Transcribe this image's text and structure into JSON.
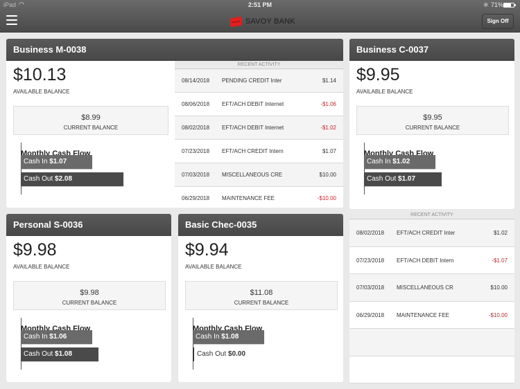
{
  "status_bar": {
    "carrier": "iPad",
    "time": "2:51 PM",
    "battery_pct": "71%",
    "battery_level": 0.71
  },
  "header": {
    "menu_icon": "hamburger-icon",
    "brand": "SAVOY BANK",
    "sign_off_label": "Sign Off"
  },
  "labels": {
    "available_balance": "AVAILABLE BALANCE",
    "current_balance": "CURRENT BALANCE",
    "monthly_cash_flow": "Monthly Cash Flow",
    "cash_in": "Cash In",
    "cash_out": "Cash Out",
    "recent_activity": "RECENT ACTIVITY"
  },
  "accounts": [
    {
      "name": "Business M-0038",
      "available": "$10.13",
      "current": "$8.99",
      "cash_in": "$1.07",
      "cash_out": "$2.08",
      "cash_in_value": 1.07,
      "cash_out_value": 2.08,
      "activity": [
        {
          "date": "08/14/2018",
          "desc": "PENDING CREDIT Inter",
          "amount": "$1.14",
          "negative": false
        },
        {
          "date": "08/06/2018",
          "desc": "EFT/ACH DEBIT Internet",
          "amount": "-$1.06",
          "negative": true
        },
        {
          "date": "08/02/2018",
          "desc": "EFT/ACH DEBIT Internet",
          "amount": "-$1.02",
          "negative": true
        },
        {
          "date": "07/23/2018",
          "desc": "EFT/ACH CREDIT Intern",
          "amount": "$1.07",
          "negative": false
        },
        {
          "date": "07/03/2018",
          "desc": "MISCELLANEOUS CRE",
          "amount": "$10.00",
          "negative": false
        },
        {
          "date": "06/29/2018",
          "desc": "MAINTENANCE FEE",
          "amount": "-$10.00",
          "negative": true
        }
      ]
    },
    {
      "name": "Business C-0037",
      "available": "$9.95",
      "current": "$9.95",
      "cash_in": "$1.02",
      "cash_out": "$1.07",
      "cash_in_value": 1.02,
      "cash_out_value": 1.07,
      "activity": [
        {
          "date": "08/02/2018",
          "desc": "EFT/ACH CREDIT Inter",
          "amount": "$1.02",
          "negative": false
        },
        {
          "date": "07/23/2018",
          "desc": "EFT/ACH DEBIT Intern",
          "amount": "-$1.07",
          "negative": true
        },
        {
          "date": "07/03/2018",
          "desc": "MISCELLANEOUS CR",
          "amount": "$10.00",
          "negative": false
        },
        {
          "date": "06/29/2018",
          "desc": "MAINTENANCE FEE",
          "amount": "-$10.00",
          "negative": true
        }
      ]
    },
    {
      "name": "Personal S-0036",
      "available": "$9.98",
      "current": "$9.98",
      "cash_in": "$1.06",
      "cash_out": "$1.08",
      "cash_in_value": 1.06,
      "cash_out_value": 1.08
    },
    {
      "name": "Basic Chec-0035",
      "available": "$9.94",
      "current": "$11.08",
      "cash_in": "$1.08",
      "cash_out": "$0.00",
      "cash_in_value": 1.08,
      "cash_out_value": 0.0
    }
  ]
}
